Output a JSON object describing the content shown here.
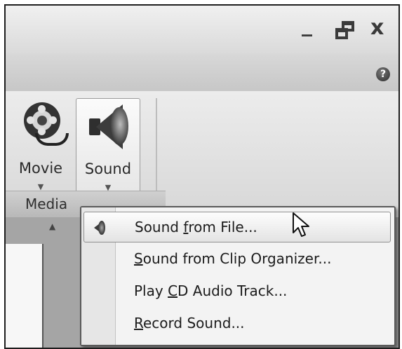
{
  "window": {
    "minimize_glyph": "_",
    "close_glyph": "x"
  },
  "help": {
    "glyph": "?"
  },
  "ribbon": {
    "buttons": [
      {
        "label": "Movie",
        "icon": "film-reel-icon"
      },
      {
        "label": "Sound",
        "icon": "speaker-icon"
      }
    ],
    "group_label": "Media"
  },
  "menu": {
    "items": [
      {
        "before": "Sound ",
        "accel": "f",
        "after": "rom File...",
        "icon": "speaker-icon",
        "highlighted": true
      },
      {
        "before": "",
        "accel": "S",
        "after": "ound from Clip Organizer...",
        "highlighted": false
      },
      {
        "before": "Play ",
        "accel": "C",
        "after": "D Audio Track...",
        "highlighted": false
      },
      {
        "before": "",
        "accel": "R",
        "after": "ecord Sound...",
        "highlighted": false
      }
    ]
  },
  "colors": {
    "menu_background": "#f3f3f3",
    "highlight": "#e3e3e3",
    "frame": "#1d1d1d"
  }
}
